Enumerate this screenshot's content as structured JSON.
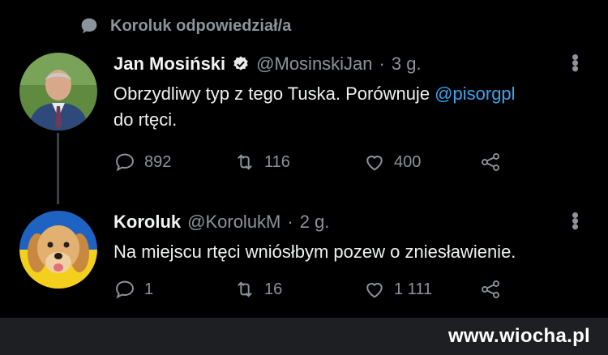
{
  "reply_context": {
    "text": "Koroluk odpowiedział/a"
  },
  "tweets": [
    {
      "name": "Jan Mosiński",
      "handle": "@MosinskiJan",
      "time": "3 g.",
      "verified": true,
      "body_text": "Obrzydliwy typ z tego Tuska. Porównuje ",
      "mention": "@pisorgpl",
      "body_text_2": " do rtęci.",
      "replies": "892",
      "retweets": "116",
      "likes": "400"
    },
    {
      "name": "Koroluk",
      "handle": "@KorolukM",
      "time": "2 g.",
      "body_text": "Na miejscu rtęci wniósłbym pozew o zniesławienie.",
      "replies": "1",
      "retweets": "16",
      "likes": "1 111"
    }
  ],
  "watermark": "www.wiocha.pl",
  "separator": "·",
  "colors": {
    "background": "#000000",
    "mention": "#3aa3ee",
    "muted": "#8b949a"
  }
}
